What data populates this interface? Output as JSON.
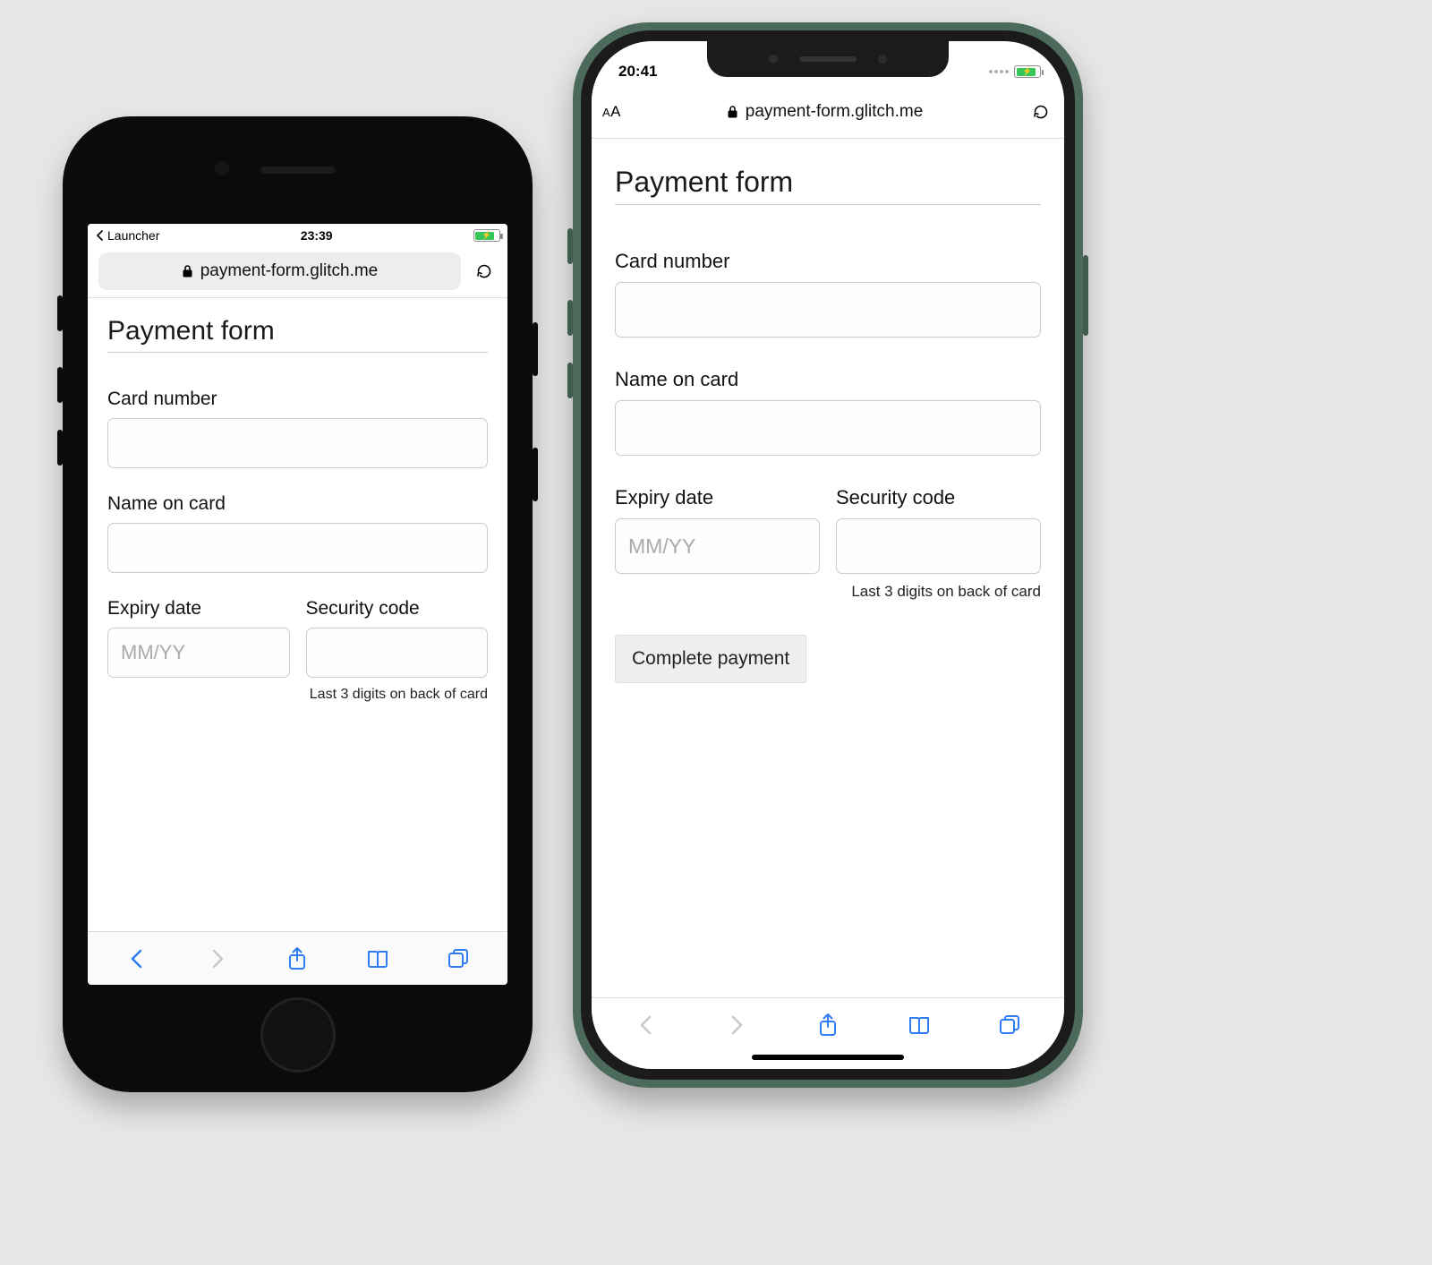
{
  "left_phone": {
    "status_bar": {
      "back_app": "Launcher",
      "time": "23:39"
    },
    "url_bar": {
      "domain": "payment-form.glitch.me"
    },
    "form": {
      "title": "Payment form",
      "card_number_label": "Card number",
      "name_on_card_label": "Name on card",
      "expiry_label": "Expiry date",
      "expiry_placeholder": "MM/YY",
      "security_label": "Security code",
      "security_hint": "Last 3 digits on back of card"
    }
  },
  "right_phone": {
    "status_bar": {
      "time": "20:41"
    },
    "url_bar": {
      "aa": "AA",
      "domain": "payment-form.glitch.me"
    },
    "form": {
      "title": "Payment form",
      "card_number_label": "Card number",
      "name_on_card_label": "Name on card",
      "expiry_label": "Expiry date",
      "expiry_placeholder": "MM/YY",
      "security_label": "Security code",
      "security_hint": "Last 3 digits on back of card",
      "submit_label": "Complete payment"
    }
  }
}
